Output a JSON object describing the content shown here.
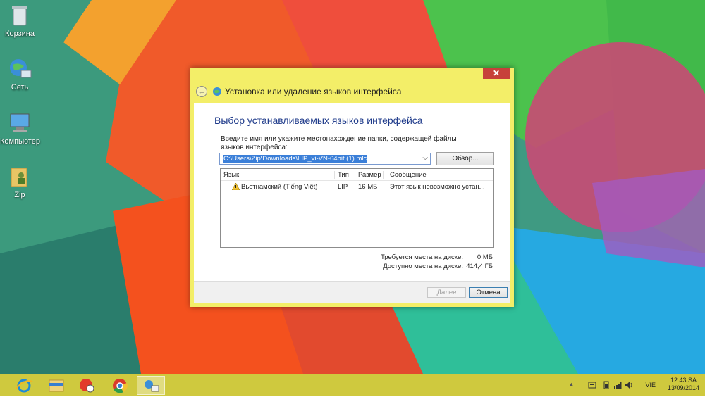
{
  "desktop": {
    "icons": [
      {
        "label": "Корзина",
        "icon": "recycle-bin-icon"
      },
      {
        "label": "Сеть",
        "icon": "network-icon"
      },
      {
        "label": "Компьютер",
        "icon": "computer-icon"
      },
      {
        "label": "Zip",
        "icon": "folder-user-icon"
      }
    ]
  },
  "dialog": {
    "close_label": "✕",
    "title": "Установка или удаление языков интерфейса",
    "heading": "Выбор устанавливаемых языков интерфейса",
    "instruction": "Введите имя или укажите местонахождение папки, содержащей файлы языков интерфейса:",
    "path_value": "C:\\Users\\Zip\\Downloads\\LIP_vi-VN-64bit (1).mlc",
    "browse_label": "Обзор...",
    "table": {
      "headers": [
        "Язык",
        "Тип",
        "Размер",
        "Сообщение"
      ],
      "rows": [
        {
          "language": "Вьетнамский (Tiếng Việt)",
          "type": "LIP",
          "size": "16 МБ",
          "message": "Этот язык невозможно устан...",
          "status_icon": "warning-icon"
        }
      ]
    },
    "disk": {
      "required_label": "Требуется места на диске:",
      "required_value": "0 МБ",
      "available_label": "Доступно места на диске:",
      "available_value": "414,4 ГБ"
    },
    "next_label": "Далее",
    "cancel_label": "Отмена"
  },
  "taskbar": {
    "apps": [
      {
        "name": "internet-explorer-icon"
      },
      {
        "name": "file-explorer-icon"
      },
      {
        "name": "app-red-icon"
      },
      {
        "name": "chrome-icon"
      },
      {
        "name": "language-settings-icon"
      }
    ],
    "language": "VIE",
    "time": "12:43 SA",
    "date": "13/09/2014"
  },
  "colors": {
    "dialog_frame": "#f3ee68",
    "taskbar": "#cfc93e",
    "heading": "#1e3a8a",
    "selection": "#3b7fd8"
  }
}
